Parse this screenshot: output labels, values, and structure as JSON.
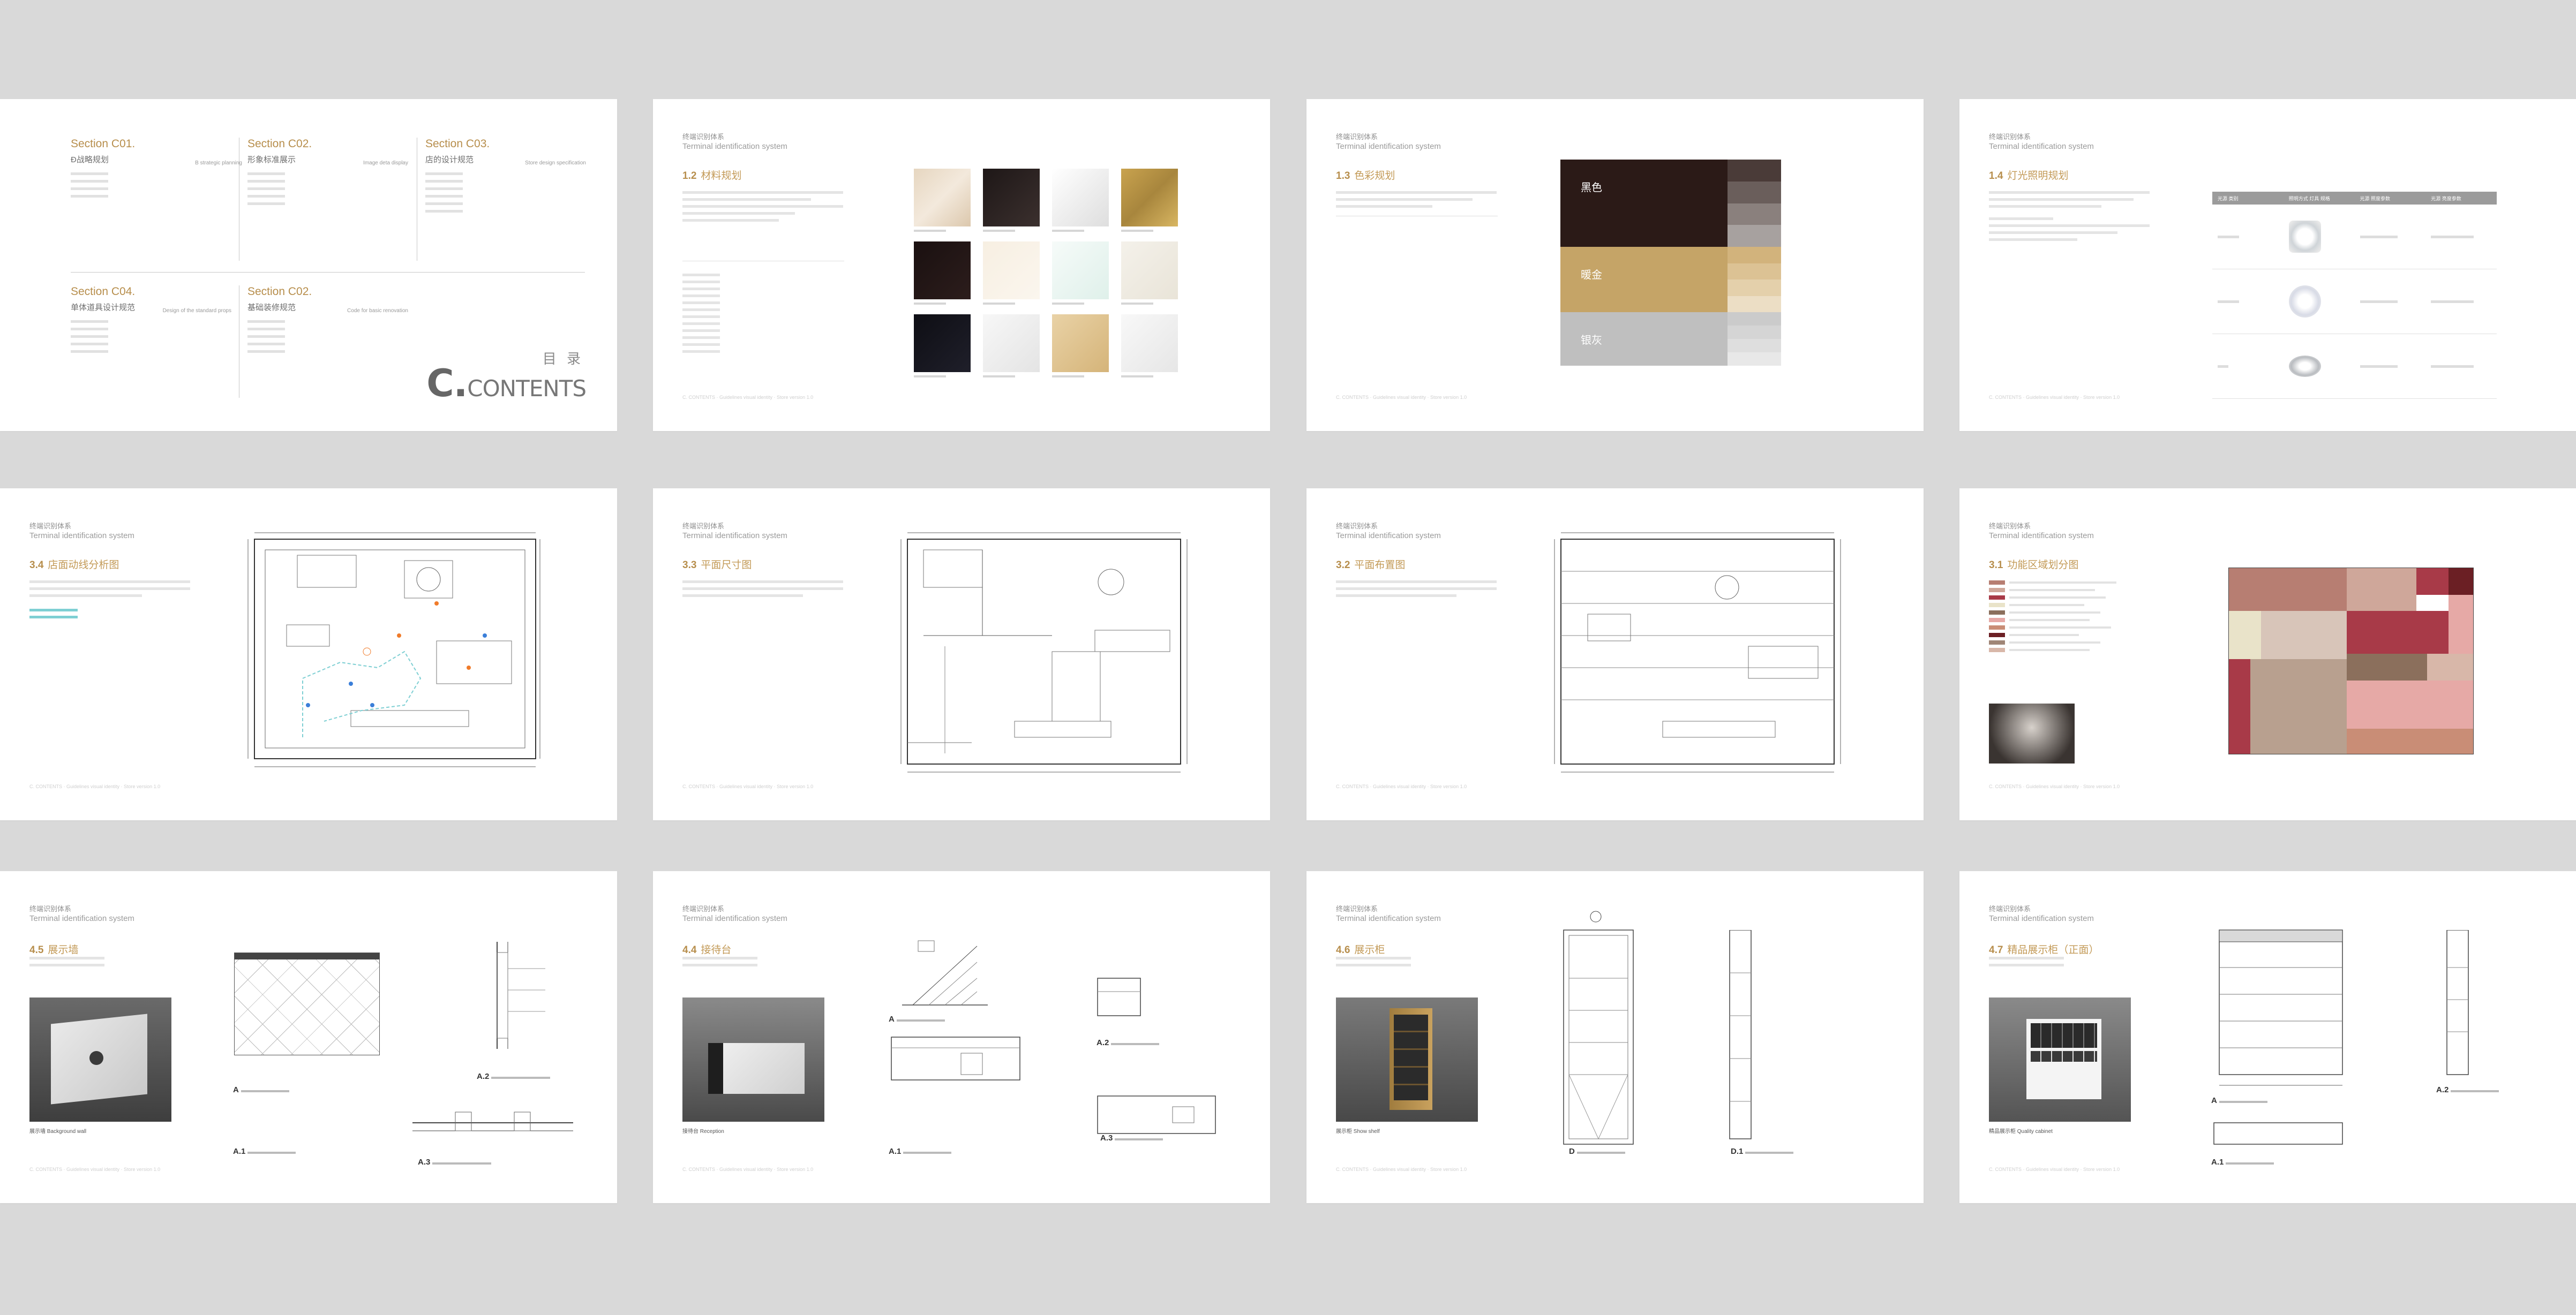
{
  "contents": {
    "cn": "目 录",
    "big": "C.",
    "en": "CONTENTS",
    "sections": [
      {
        "head": "Section C01.",
        "cn": "Ð战略规划",
        "en": "B strategic planning"
      },
      {
        "head": "Section C02.",
        "cn": "形象标准展示",
        "en": "Image deta display"
      },
      {
        "head": "Section C03.",
        "cn": "店的设计规范",
        "en": "Store design specification"
      },
      {
        "head": "Section C04.",
        "cn": "单体道具设计规范",
        "en": "Design of the standard props"
      },
      {
        "head": "Section C02.",
        "cn": "基础装修规范",
        "en": "Code for basic renovation"
      }
    ]
  },
  "common": {
    "hdr_cn": "终端识别体系",
    "hdr_en": "Terminal identification system",
    "footer": "C. CONTENTS · Guidelines visual identity · Store version 1.0"
  },
  "p2": {
    "num": "1.2",
    "title": "材料规划"
  },
  "p3": {
    "num": "1.3",
    "title": "色彩规划",
    "palette": [
      {
        "label": "黑色",
        "base": "#2b1a17",
        "steps": [
          "#4a3b38",
          "#6a5e5b",
          "#8a807d",
          "#a7a19f"
        ]
      },
      {
        "label": "暖金",
        "base": "#c5a467",
        "steps": [
          "#d2b37c",
          "#dcc294",
          "#e4d0ab",
          "#ecdec5"
        ]
      },
      {
        "label": "银灰",
        "base": "#bfbfbf",
        "steps": [
          "#cbcbcb",
          "#d5d5d5",
          "#dedede",
          "#e8e8e8"
        ]
      }
    ]
  },
  "p4": {
    "num": "1.4",
    "title": "灯光照明规划",
    "table_headers": [
      "光源 类别",
      "照明方式 灯具 规格",
      "光源 照度参数",
      "光源 亮度参数"
    ]
  },
  "p5": {
    "num": "3.4",
    "title": "店面动线分析图"
  },
  "p6": {
    "num": "3.3",
    "title": "平面尺寸图"
  },
  "p7": {
    "num": "3.2",
    "title": "平面布置图"
  },
  "p8": {
    "num": "3.1",
    "title": "功能区域划分图"
  },
  "p9": {
    "num": "4.5",
    "title": "展示墙",
    "labels": [
      "A",
      "A.1",
      "A.2",
      "A.3"
    ],
    "photo_caption": "展示墙 Background wall"
  },
  "p10": {
    "num": "4.4",
    "title": "接待台",
    "labels": [
      "A",
      "A.1",
      "A.2",
      "A.3"
    ],
    "photo_caption": "接待台 Reception"
  },
  "p11": {
    "num": "4.6",
    "title": "展示柜",
    "labels": [
      "D",
      "D.1"
    ],
    "photo_caption": "展示柜 Show shelf"
  },
  "p12": {
    "num": "4.7",
    "title": "精品展示柜（正面）",
    "labels": [
      "A",
      "A.1",
      "A.2"
    ],
    "photo_caption": "精品展示柜 Quality cabinet"
  },
  "colors": {
    "accent": "#c39a57",
    "background": "#d9d9d9"
  }
}
